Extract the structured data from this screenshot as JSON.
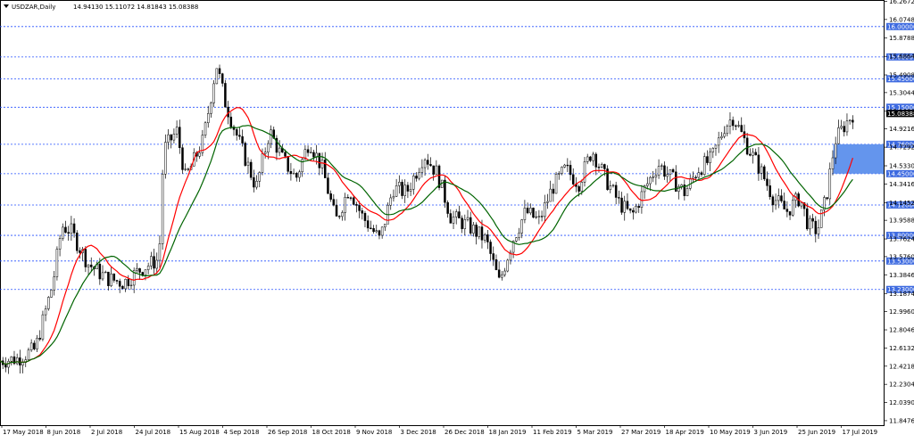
{
  "chart_data": {
    "type": "candlestick",
    "header": {
      "symbol_label": "USDZAR,Daily",
      "ohlc": "14.94130 15.11072 14.81843 15.08388"
    },
    "y_axis": {
      "range": [
        11.8,
        16.28
      ],
      "ticks": [
        "16.26720",
        "16.07480",
        "15.87880",
        "15.68640",
        "15.49080",
        "15.30440",
        "15.10800",
        "14.92160",
        "14.72920",
        "14.53300",
        "14.34160",
        "14.14520",
        "13.95880",
        "13.76240",
        "13.57600",
        "13.38460",
        "13.18740",
        "12.99600",
        "12.80460",
        "12.61320",
        "12.42180",
        "12.23040",
        "12.03900",
        "11.84760"
      ],
      "tick_values": [
        16.2672,
        16.0748,
        15.8788,
        15.6864,
        15.4908,
        15.3044,
        15.108,
        14.9216,
        14.7292,
        14.533,
        14.3416,
        14.1452,
        13.9588,
        13.7624,
        13.576,
        13.3846,
        13.1874,
        12.996,
        12.8046,
        12.6132,
        12.4218,
        12.2304,
        12.039,
        11.8476
      ]
    },
    "x_axis": {
      "tick_labels": [
        "17 May 2018",
        "8 Jun 2018",
        "2 Jul 2018",
        "24 Jul 2018",
        "15 Aug 2018",
        "4 Sep 2018",
        "26 Sep 2018",
        "18 Oct 2018",
        "9 Nov 2018",
        "3 Dec 2018",
        "26 Dec 2018",
        "18 Jan 2019",
        "11 Feb 2019",
        "5 Mar 2019",
        "27 Mar 2019",
        "18 Apr 2019",
        "10 May 2019",
        "3 Jun 2019",
        "25 Jun 2019",
        "17 Jul 2019"
      ]
    },
    "horizontal_levels": [
      {
        "label": "16.00000",
        "value": 16.0
      },
      {
        "label": "15.68000",
        "value": 15.68
      },
      {
        "label": "15.45000",
        "value": 15.45
      },
      {
        "label": "15.15000",
        "value": 15.15
      },
      {
        "label": "14.76000",
        "value": 14.76
      },
      {
        "label": "14.45000",
        "value": 14.45
      },
      {
        "label": "14.12000",
        "value": 14.12
      },
      {
        "label": "13.80000",
        "value": 13.8
      },
      {
        "label": "13.53000",
        "value": 13.53
      },
      {
        "label": "13.23000",
        "value": 13.23
      }
    ],
    "current_price": {
      "label": "15.08388",
      "value": 15.08388
    },
    "zone": {
      "from_value": 14.45,
      "to_value": 14.76,
      "x_start_fraction": 0.943,
      "x_end_fraction": 1.0
    },
    "price_path": [
      [
        0,
        12.48
      ],
      [
        0.02,
        12.5
      ],
      [
        0.04,
        12.6
      ],
      [
        0.06,
        13.3
      ],
      [
        0.07,
        13.9
      ],
      [
        0.08,
        13.85
      ],
      [
        0.1,
        13.5
      ],
      [
        0.12,
        13.35
      ],
      [
        0.14,
        13.3
      ],
      [
        0.16,
        13.45
      ],
      [
        0.18,
        13.55
      ],
      [
        0.185,
        14.7
      ],
      [
        0.2,
        14.9
      ],
      [
        0.21,
        14.4
      ],
      [
        0.23,
        14.8
      ],
      [
        0.245,
        15.6
      ],
      [
        0.255,
        15.2
      ],
      [
        0.27,
        14.8
      ],
      [
        0.29,
        14.3
      ],
      [
        0.305,
        14.9
      ],
      [
        0.32,
        14.6
      ],
      [
        0.335,
        14.4
      ],
      [
        0.35,
        14.8
      ],
      [
        0.365,
        14.5
      ],
      [
        0.38,
        13.95
      ],
      [
        0.395,
        14.3
      ],
      [
        0.41,
        14.0
      ],
      [
        0.43,
        13.75
      ],
      [
        0.445,
        14.3
      ],
      [
        0.46,
        14.25
      ],
      [
        0.48,
        14.65
      ],
      [
        0.495,
        14.45
      ],
      [
        0.51,
        14.0
      ],
      [
        0.53,
        13.9
      ],
      [
        0.55,
        13.75
      ],
      [
        0.565,
        13.3
      ],
      [
        0.58,
        13.75
      ],
      [
        0.595,
        14.05
      ],
      [
        0.61,
        13.95
      ],
      [
        0.625,
        14.3
      ],
      [
        0.64,
        14.5
      ],
      [
        0.655,
        14.35
      ],
      [
        0.67,
        14.7
      ],
      [
        0.685,
        14.4
      ],
      [
        0.7,
        14.15
      ],
      [
        0.715,
        14.0
      ],
      [
        0.73,
        14.3
      ],
      [
        0.745,
        14.55
      ],
      [
        0.76,
        14.4
      ],
      [
        0.775,
        14.25
      ],
      [
        0.79,
        14.5
      ],
      [
        0.805,
        14.6
      ],
      [
        0.82,
        14.95
      ],
      [
        0.83,
        15.05
      ],
      [
        0.845,
        14.75
      ],
      [
        0.86,
        14.5
      ],
      [
        0.875,
        14.2
      ],
      [
        0.89,
        14.05
      ],
      [
        0.905,
        14.2
      ],
      [
        0.915,
        13.9
      ],
      [
        0.925,
        13.85
      ],
      [
        0.935,
        14.2
      ],
      [
        0.945,
        14.8
      ],
      [
        0.955,
        14.95
      ],
      [
        0.965,
        15.08
      ]
    ],
    "moving_averages": [
      {
        "color": "#ff0000",
        "period": 13
      },
      {
        "color": "#006400",
        "period": 21
      }
    ],
    "colors": {
      "grid_level": "#2650ff",
      "level_label_bg": "#3d6ae0",
      "zone_fill": "#6495ed",
      "candle": "#000000",
      "current_price_bg": "#000000"
    }
  }
}
